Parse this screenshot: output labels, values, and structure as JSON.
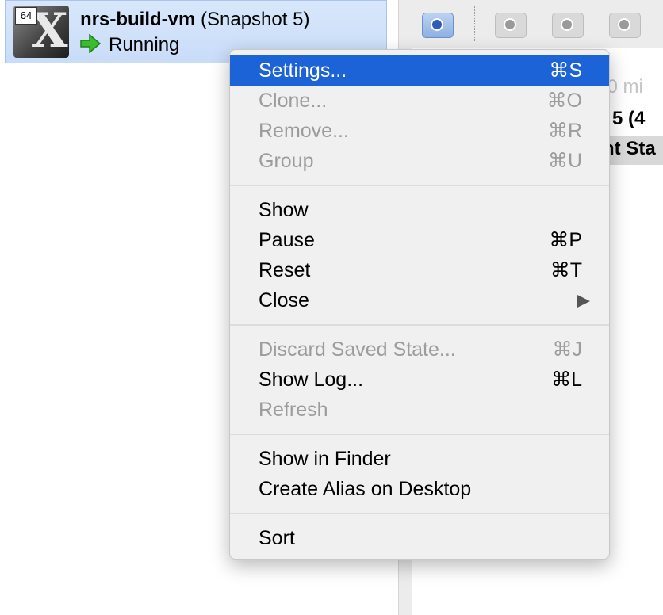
{
  "vm": {
    "os_badge": "64",
    "name": "nrs-build-vm",
    "snapshot": "(Snapshot 5)",
    "state": "Running"
  },
  "snapshots_bg": {
    "line1": "Snapshot 4 (40 mi",
    "line2": "Snapshot 5 (4",
    "line3": "Current Sta"
  },
  "menu": {
    "settings": {
      "label": "Settings...",
      "shortcut": "⌘S"
    },
    "clone": {
      "label": "Clone...",
      "shortcut": "⌘O"
    },
    "remove": {
      "label": "Remove...",
      "shortcut": "⌘R"
    },
    "group": {
      "label": "Group",
      "shortcut": "⌘U"
    },
    "show": {
      "label": "Show"
    },
    "pause": {
      "label": "Pause",
      "shortcut": "⌘P"
    },
    "reset": {
      "label": "Reset",
      "shortcut": "⌘T"
    },
    "close": {
      "label": "Close"
    },
    "discard": {
      "label": "Discard Saved State...",
      "shortcut": "⌘J"
    },
    "show_log": {
      "label": "Show Log...",
      "shortcut": "⌘L"
    },
    "refresh": {
      "label": "Refresh"
    },
    "show_in_finder": {
      "label": "Show in Finder"
    },
    "create_alias": {
      "label": "Create Alias on Desktop"
    },
    "sort": {
      "label": "Sort"
    }
  },
  "colors": {
    "highlight": "#1b63d6",
    "selection_row": "#d8e7fb",
    "running_arrow": "#3dbb2f"
  },
  "icons": [
    "os-x-icon",
    "running-arrow-icon",
    "take-snapshot-icon",
    "restore-snapshot-icon",
    "delete-snapshot-icon",
    "snapshot-details-icon",
    "submenu-arrow-icon"
  ]
}
